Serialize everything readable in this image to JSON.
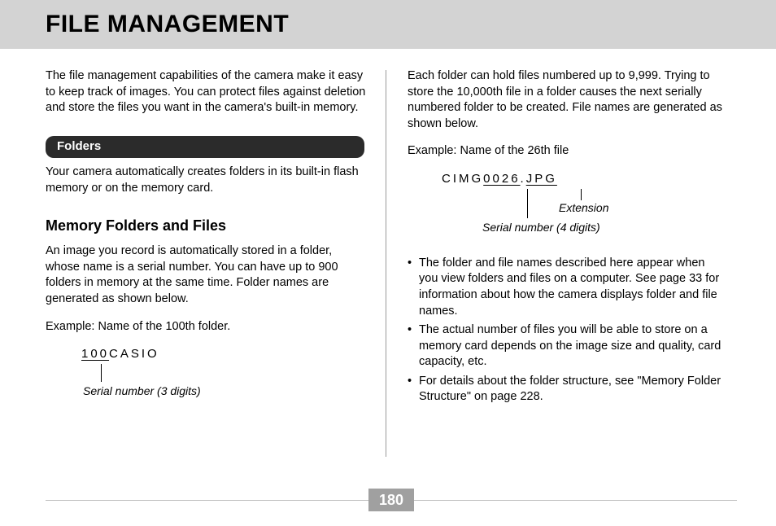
{
  "header": {
    "title": "FILE MANAGEMENT"
  },
  "left": {
    "intro": "The file management capabilities of the camera make it easy to keep track of images. You can protect files against deletion and store the files you want in the camera's built-in memory.",
    "section_label": "Folders",
    "folders_para": "Your camera automatically creates folders in its built-in flash memory or on the memory card.",
    "subhead": "Memory Folders and Files",
    "mem_para": "An image you record is automatically stored in a folder, whose name is a serial number. You can have up to 900 folders in memory at the same time. Folder names are generated as shown below.",
    "example_label": "Example: Name of the 100th folder.",
    "folder_serial": "100",
    "folder_suffix": "CASIO",
    "folder_annot": "Serial number (3 digits)"
  },
  "right": {
    "intro": "Each folder can hold files numbered up to 9,999. Trying to store the 10,000th file in a folder causes the next serially numbered folder to be created. File names are generated as shown below.",
    "example_label": "Example: Name of the 26th file",
    "file_prefix": "CIMG",
    "file_serial": "0026",
    "file_dot": ".",
    "file_ext": "JPG",
    "annot_ext": "Extension",
    "annot_serial": "Serial number (4 digits)",
    "bullets": [
      "The folder and file names described here appear when you view folders and files on a computer. See page 33 for information about how the camera displays folder and file names.",
      "The actual number of files you will be able to store on a memory card depends on the image size and quality, card capacity, etc.",
      "For details about the folder structure, see \"Memory Folder Structure\" on page 228."
    ]
  },
  "page_number": "180"
}
